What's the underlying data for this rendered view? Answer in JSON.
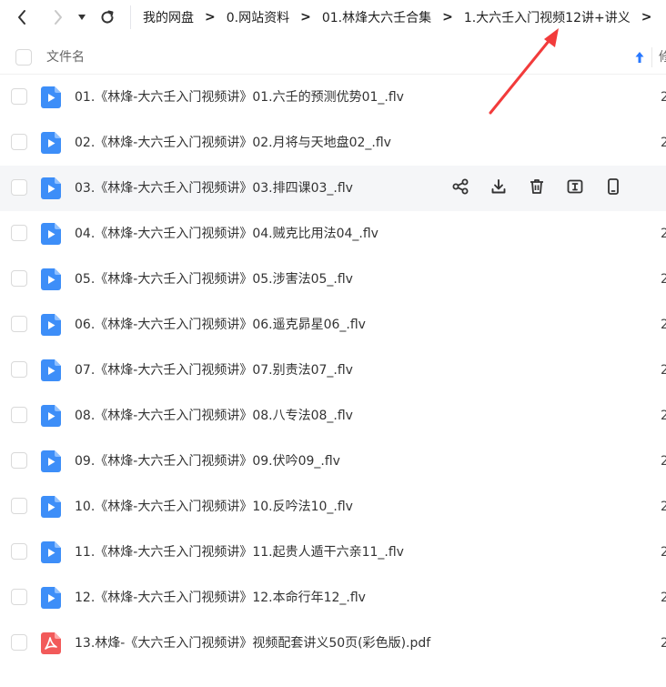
{
  "toolbar": {
    "breadcrumb": [
      "我的网盘",
      "0.网站资料",
      "01.林烽大六壬合集",
      "1.大六壬入门视频12讲+讲义"
    ]
  },
  "header": {
    "name_label": "文件名",
    "cut_label": "修"
  },
  "files": [
    {
      "name": "01.《林烽-大六壬入门视频讲》01.六壬的预测优势01_.flv",
      "type": "video",
      "trail": "2"
    },
    {
      "name": "02.《林烽-大六壬入门视频讲》02.月将与天地盘02_.flv",
      "type": "video",
      "trail": "2"
    },
    {
      "name": "03.《林烽-大六壬入门视频讲》03.排四课03_.flv",
      "type": "video",
      "trail": "",
      "hover": true
    },
    {
      "name": "04.《林烽-大六壬入门视频讲》04.贼克比用法04_.flv",
      "type": "video",
      "trail": "2"
    },
    {
      "name": "05.《林烽-大六壬入门视频讲》05.涉害法05_.flv",
      "type": "video",
      "trail": "2"
    },
    {
      "name": "06.《林烽-大六壬入门视频讲》06.遥克昴星06_.flv",
      "type": "video",
      "trail": "2"
    },
    {
      "name": "07.《林烽-大六壬入门视频讲》07.别责法07_.flv",
      "type": "video",
      "trail": "2"
    },
    {
      "name": "08.《林烽-大六壬入门视频讲》08.八专法08_.flv",
      "type": "video",
      "trail": "2"
    },
    {
      "name": "09.《林烽-大六壬入门视频讲》09.伏吟09_.flv",
      "type": "video",
      "trail": "2"
    },
    {
      "name": "10.《林烽-大六壬入门视频讲》10.反吟法10_.flv",
      "type": "video",
      "trail": "2"
    },
    {
      "name": "11.《林烽-大六壬入门视频讲》11.起贵人遁干六亲11_.flv",
      "type": "video",
      "trail": "2"
    },
    {
      "name": "12.《林烽-大六壬入门视频讲》12.本命行年12_.flv",
      "type": "video",
      "trail": "2"
    },
    {
      "name": "13.林烽-《大六壬入门视频讲》视频配套讲义50页(彩色版).pdf",
      "type": "pdf",
      "trail": "2"
    }
  ],
  "row_actions": [
    "share-icon",
    "download-icon",
    "delete-icon",
    "rename-icon",
    "phone-icon"
  ],
  "colors": {
    "video_icon": "#3d8ef8",
    "pdf_icon": "#f25a5a",
    "sort_arrow": "#2878ff",
    "annotation_arrow": "#f23b3b"
  }
}
